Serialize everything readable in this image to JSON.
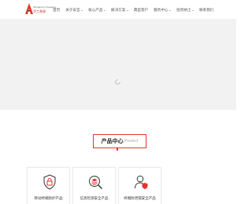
{
  "brand": {
    "name_en": "Chinaprom Systems",
    "name_cn": "华工普源",
    "accent_color": "#e8332c"
  },
  "nav": {
    "items": [
      {
        "label": "首页",
        "has_dropdown": false
      },
      {
        "label": "关于安宜",
        "has_dropdown": true
      },
      {
        "label": "核心产品",
        "has_dropdown": true
      },
      {
        "label": "解决方案",
        "has_dropdown": true
      },
      {
        "label": "典型客户",
        "has_dropdown": false
      },
      {
        "label": "服务中心",
        "has_dropdown": true
      },
      {
        "label": "招贤纳士",
        "has_dropdown": true
      },
      {
        "label": "联系我们",
        "has_dropdown": false
      }
    ]
  },
  "banner": {
    "state": "loading",
    "spinner_icon": "loading-spinner-icon",
    "background": "#f2f2f2"
  },
  "products_section": {
    "title_cn": "产品中心",
    "title_en": "Product",
    "cards": [
      {
        "label": "移动终端防护产品",
        "icon": "shield-lock-icon"
      },
      {
        "label": "信息检测安全产品",
        "icon": "search-layers-icon"
      },
      {
        "label": "终端防泄漏安全产品",
        "icon": "user-shield-icon"
      }
    ]
  }
}
